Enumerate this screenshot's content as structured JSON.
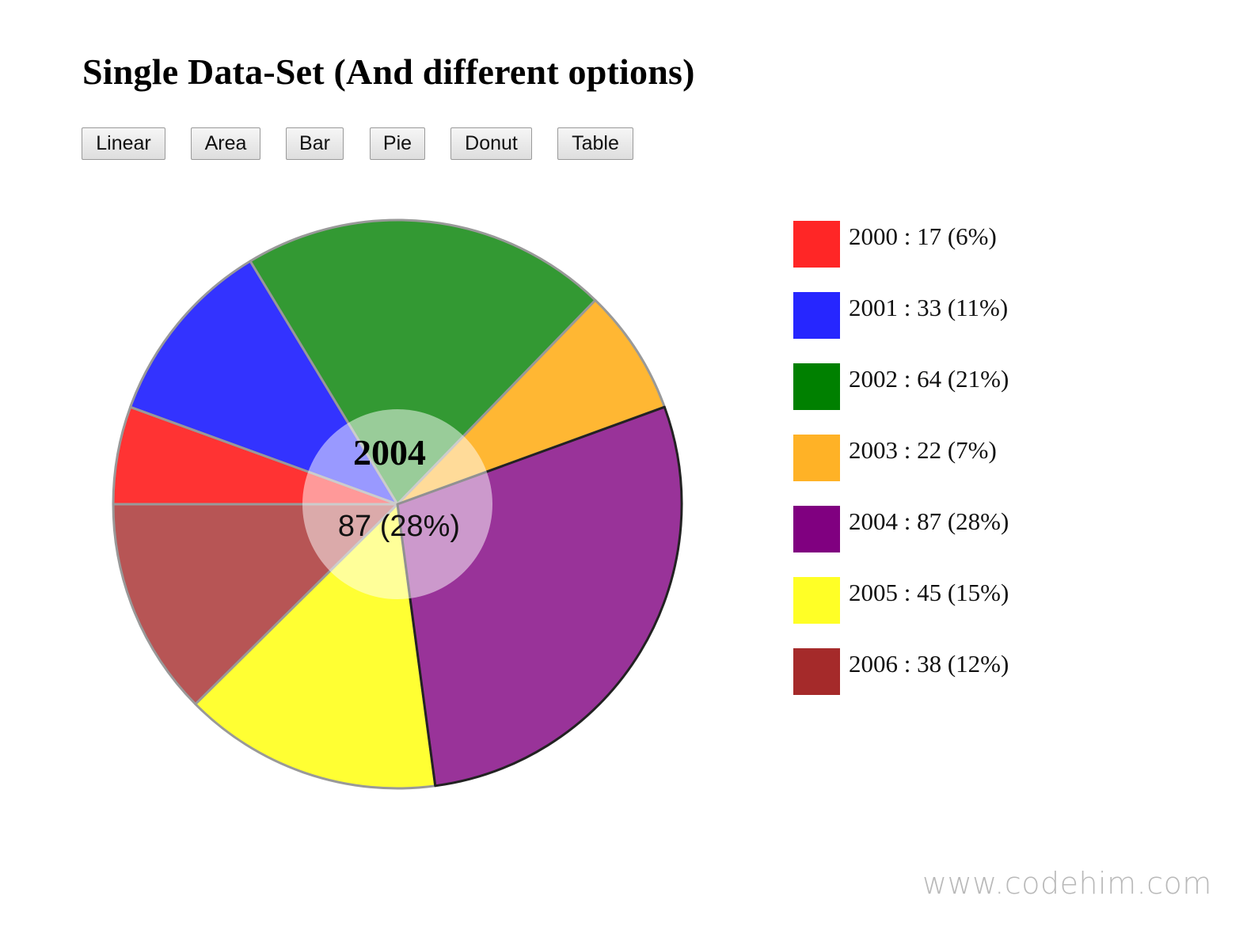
{
  "page": {
    "title": "Single Data-Set (And different options)",
    "watermark": "www.codehim.com"
  },
  "toolbar": {
    "buttons": [
      {
        "label": "Linear"
      },
      {
        "label": "Area"
      },
      {
        "label": "Bar"
      },
      {
        "label": "Pie"
      },
      {
        "label": "Donut"
      },
      {
        "label": "Table"
      }
    ]
  },
  "chart_data": {
    "type": "pie",
    "title": "Single Data-Set (And different options)",
    "categories": [
      "2000",
      "2001",
      "2002",
      "2003",
      "2004",
      "2005",
      "2006"
    ],
    "values": [
      17,
      33,
      64,
      22,
      87,
      45,
      38
    ],
    "percents": [
      "6%",
      "11%",
      "21%",
      "7%",
      "28%",
      "15%",
      "12%"
    ],
    "colors": [
      "#ff0000",
      "#0000ff",
      "#008000",
      "#ffa500",
      "#800080",
      "#ffff00",
      "#a52a2a"
    ],
    "legend_labels": [
      "2000 : 17 (6%)",
      "2001 : 33 (11%)",
      "2002 : 64 (21%)",
      "2003 : 22 (7%)",
      "2004 : 87 (28%)",
      "2005 : 45 (15%)",
      "2006 : 38 (12%)"
    ],
    "legend_position": "right",
    "start_direction": "left",
    "direction": "clockwise",
    "highlighted": {
      "category": "2004",
      "label": "2004",
      "value_label": "87 (28%)"
    }
  }
}
